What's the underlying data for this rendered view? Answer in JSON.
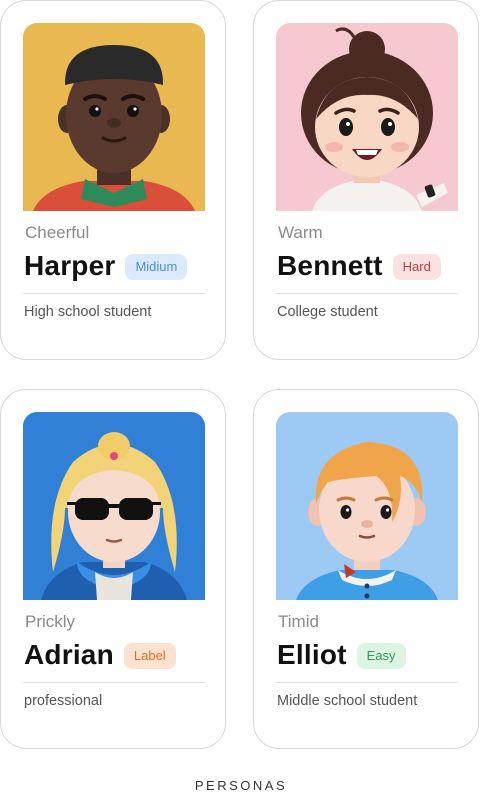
{
  "cards": [
    {
      "trait": "Cheerful",
      "name": "Harper",
      "badge": "Midium",
      "badge_color": "#4f8fd4",
      "description": "High school student",
      "avatar": "harper-avatar-image"
    },
    {
      "trait": "Warm",
      "name": "Bennett",
      "badge": "Hard",
      "badge_color": "#c23b3b",
      "description": "College student",
      "avatar": "bennett-avatar-image"
    },
    {
      "trait": "Prickly",
      "name": "Adrian",
      "badge": "Label",
      "badge_color": "#d9702a",
      "description": "professional",
      "avatar": "adrian-avatar-image"
    },
    {
      "trait": "Timid",
      "name": "Elliot",
      "badge": "Easy",
      "badge_color": "#2f9e55",
      "description": "Middle school student",
      "avatar": "elliot-avatar-image"
    }
  ],
  "footer": "PERSONAS"
}
